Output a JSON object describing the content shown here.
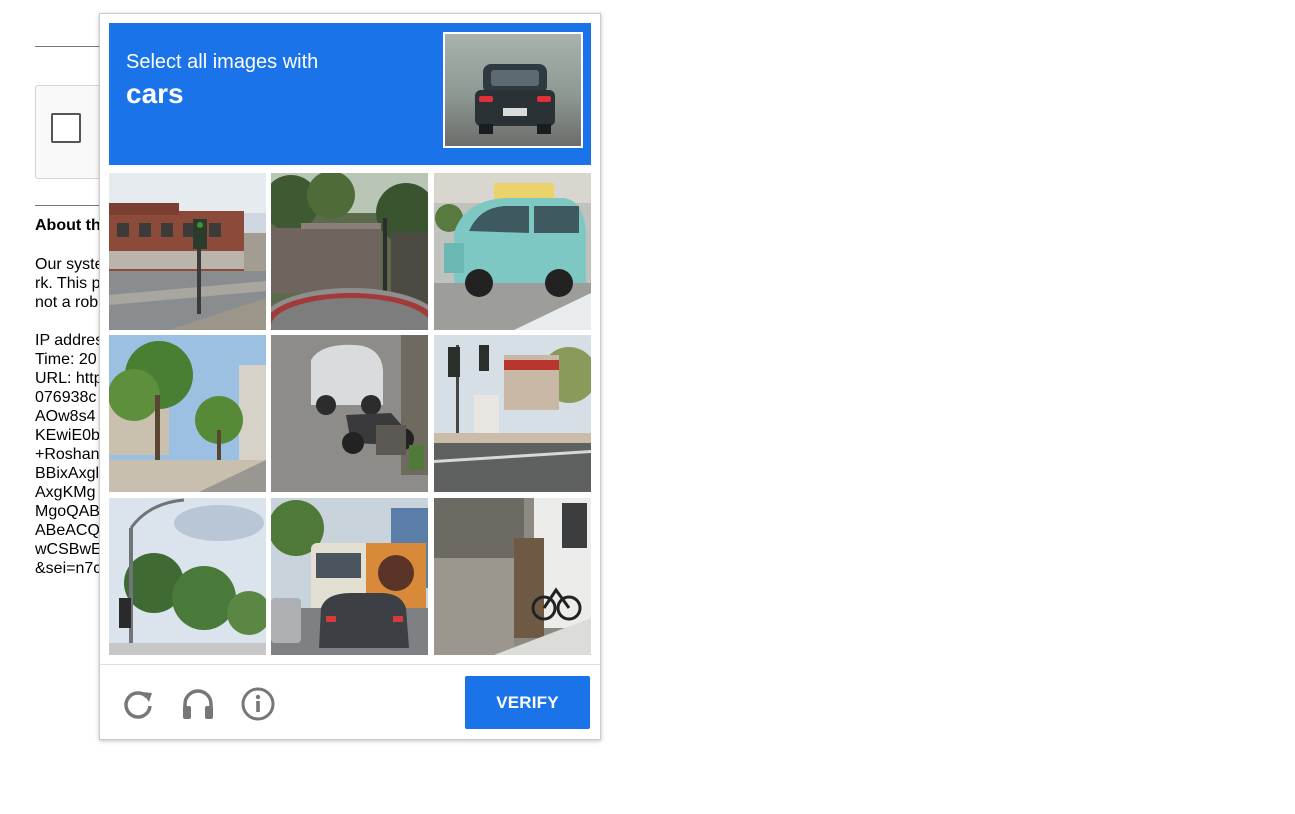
{
  "page": {
    "about_title": "About th",
    "paragraph_lines": [
      "Our syste",
      "rk. This p",
      "not a rob"
    ],
    "info_lines": [
      "IP addres",
      "Time: 20",
      "URL: http",
      "076938c",
      "AOw8s4",
      "KEwiE0b",
      "+Roshan",
      "BBixAxgl",
      "AxgKMg",
      "MgoQAB",
      "ABeACQ",
      "wCSBwE",
      "&sei=n7c"
    ]
  },
  "challenge": {
    "instruction": "Select all images with",
    "target": "cars",
    "tiles": [
      "street-corner-buildings",
      "brick-wall-hedge",
      "teal-minivan",
      "tree-lined-street",
      "parked-scooter",
      "traffic-lights-intersection",
      "street-lamp-trees",
      "bus-and-car-traffic",
      "alley-bicycle"
    ],
    "verify_label": "VERIFY",
    "footer_icons": [
      "reload-icon",
      "audio-icon",
      "info-icon"
    ]
  },
  "colors": {
    "accent": "#1a73e8",
    "icon_gray": "#777777"
  }
}
